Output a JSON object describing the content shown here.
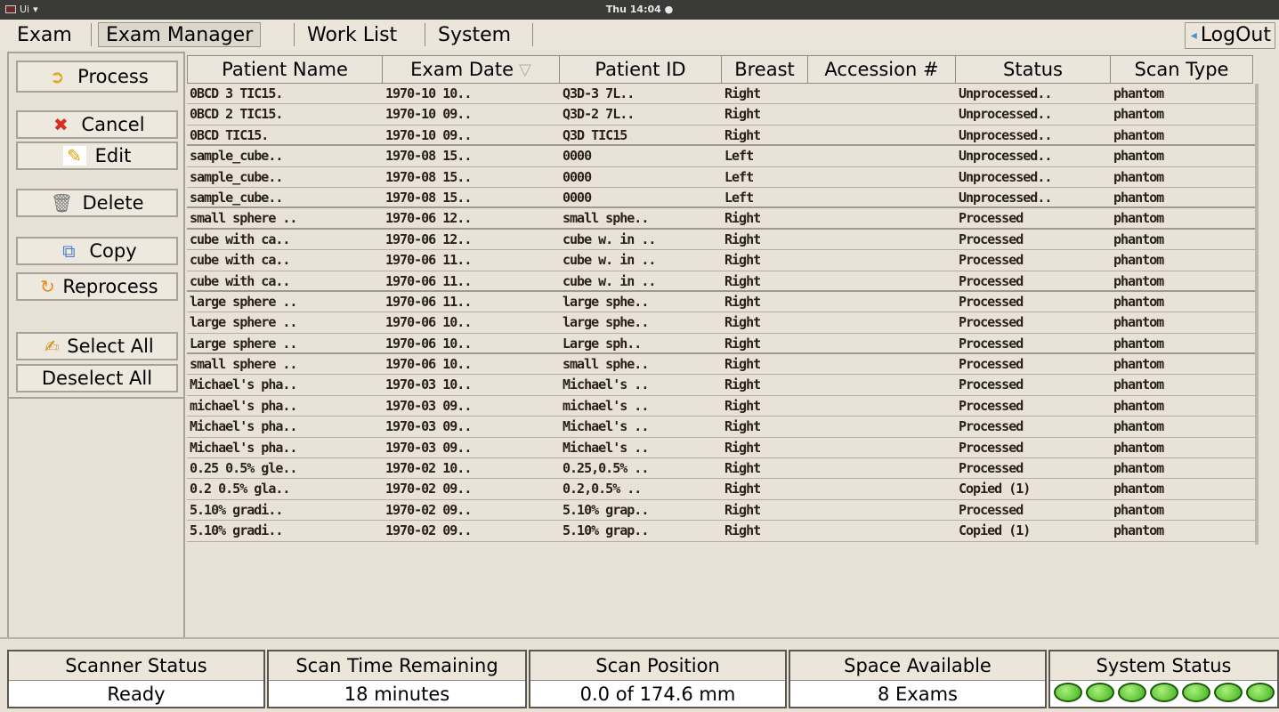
{
  "topbar": {
    "app_label": "Ui",
    "clock": "Thu 14:04"
  },
  "tabs": [
    {
      "label": "Exam"
    },
    {
      "label": "Exam Manager"
    },
    {
      "label": "Work List"
    },
    {
      "label": "System"
    }
  ],
  "logout_label": "LogOut",
  "sidebar": {
    "process": "Process",
    "cancel": "Cancel",
    "edit": "Edit",
    "delete": "Delete",
    "copy": "Copy",
    "reprocess": "Reprocess",
    "select_all": "Select All",
    "deselect_all": "Deselect All"
  },
  "table": {
    "headers": [
      "Patient Name",
      "Exam Date",
      "Patient ID",
      "Breast",
      "Accession #",
      "Status",
      "Scan Type"
    ],
    "rows": [
      [
        "0BCD 3 TIC15.",
        "1970-10 10..",
        "Q3D-3 7L..",
        "Right",
        "",
        "Unprocessed..",
        "phantom"
      ],
      [
        "0BCD 2 TIC15.",
        "1970-10 09..",
        "Q3D-2 7L..",
        "Right",
        "",
        "Unprocessed..",
        "phantom"
      ],
      [
        "0BCD TIC15.",
        "1970-10 09..",
        "Q3D TIC15",
        "Right",
        "",
        "Unprocessed..",
        "phantom"
      ],
      [
        "sample_cube..",
        "1970-08 15..",
        "0000",
        "Left",
        "",
        "Unprocessed..",
        "phantom"
      ],
      [
        "sample_cube..",
        "1970-08 15..",
        "0000",
        "Left",
        "",
        "Unprocessed..",
        "phantom"
      ],
      [
        "sample_cube..",
        "1970-08 15..",
        "0000",
        "Left",
        "",
        "Unprocessed..",
        "phantom"
      ],
      [
        "small sphere ..",
        "1970-06 12..",
        "small sphe..",
        "Right",
        "",
        "Processed",
        "phantom"
      ],
      [
        "cube with ca..",
        "1970-06 12..",
        "cube w. in ..",
        "Right",
        "",
        "Processed",
        "phantom"
      ],
      [
        "cube with ca..",
        "1970-06 11..",
        "cube w. in ..",
        "Right",
        "",
        "Processed",
        "phantom"
      ],
      [
        "cube with ca..",
        "1970-06 11..",
        "cube w. in ..",
        "Right",
        "",
        "Processed",
        "phantom"
      ],
      [
        "large sphere ..",
        "1970-06 11..",
        "large sphe..",
        "Right",
        "",
        "Processed",
        "phantom"
      ],
      [
        "large sphere ..",
        "1970-06 10..",
        "large sphe..",
        "Right",
        "",
        "Processed",
        "phantom"
      ],
      [
        "Large sphere ..",
        "1970-06 10..",
        "Large sph..",
        "Right",
        "",
        "Processed",
        "phantom"
      ],
      [
        "small sphere ..",
        "1970-06 10..",
        "small sphe..",
        "Right",
        "",
        "Processed",
        "phantom"
      ],
      [
        "Michael's pha..",
        "1970-03 10..",
        "Michael's ..",
        "Right",
        "",
        "Processed",
        "phantom"
      ],
      [
        "michael's pha..",
        "1970-03 09..",
        "michael's ..",
        "Right",
        "",
        "Processed",
        "phantom"
      ],
      [
        "Michael's pha..",
        "1970-03 09..",
        "Michael's ..",
        "Right",
        "",
        "Processed",
        "phantom"
      ],
      [
        "Michael's pha..",
        "1970-03 09..",
        "Michael's ..",
        "Right",
        "",
        "Processed",
        "phantom"
      ],
      [
        "0.25 0.5% gle..",
        "1970-02 10..",
        "0.25,0.5% ..",
        "Right",
        "",
        "Processed",
        "phantom"
      ],
      [
        "0.2 0.5% gla..",
        "1970-02 09..",
        "0.2,0.5% ..",
        "Right",
        "",
        "Copied (1)",
        "phantom"
      ],
      [
        "5.10% gradi..",
        "1970-02 09..",
        "5.10% grap..",
        "Right",
        "",
        "Processed",
        "phantom"
      ],
      [
        "5.10% gradi..",
        "1970-02 09..",
        "5.10% grap..",
        "Right",
        "",
        "Copied (1)",
        "phantom"
      ]
    ]
  },
  "status": {
    "scanner_status_label": "Scanner Status",
    "scanner_status_value": "Ready",
    "scan_time_label": "Scan Time Remaining",
    "scan_time_value": "18 minutes",
    "scan_position_label": "Scan Position",
    "scan_position_value": "0.0 of 174.6 mm",
    "space_label": "Space Available",
    "space_value": "8 Exams",
    "system_status_label": "System Status",
    "system_leds": 7
  }
}
